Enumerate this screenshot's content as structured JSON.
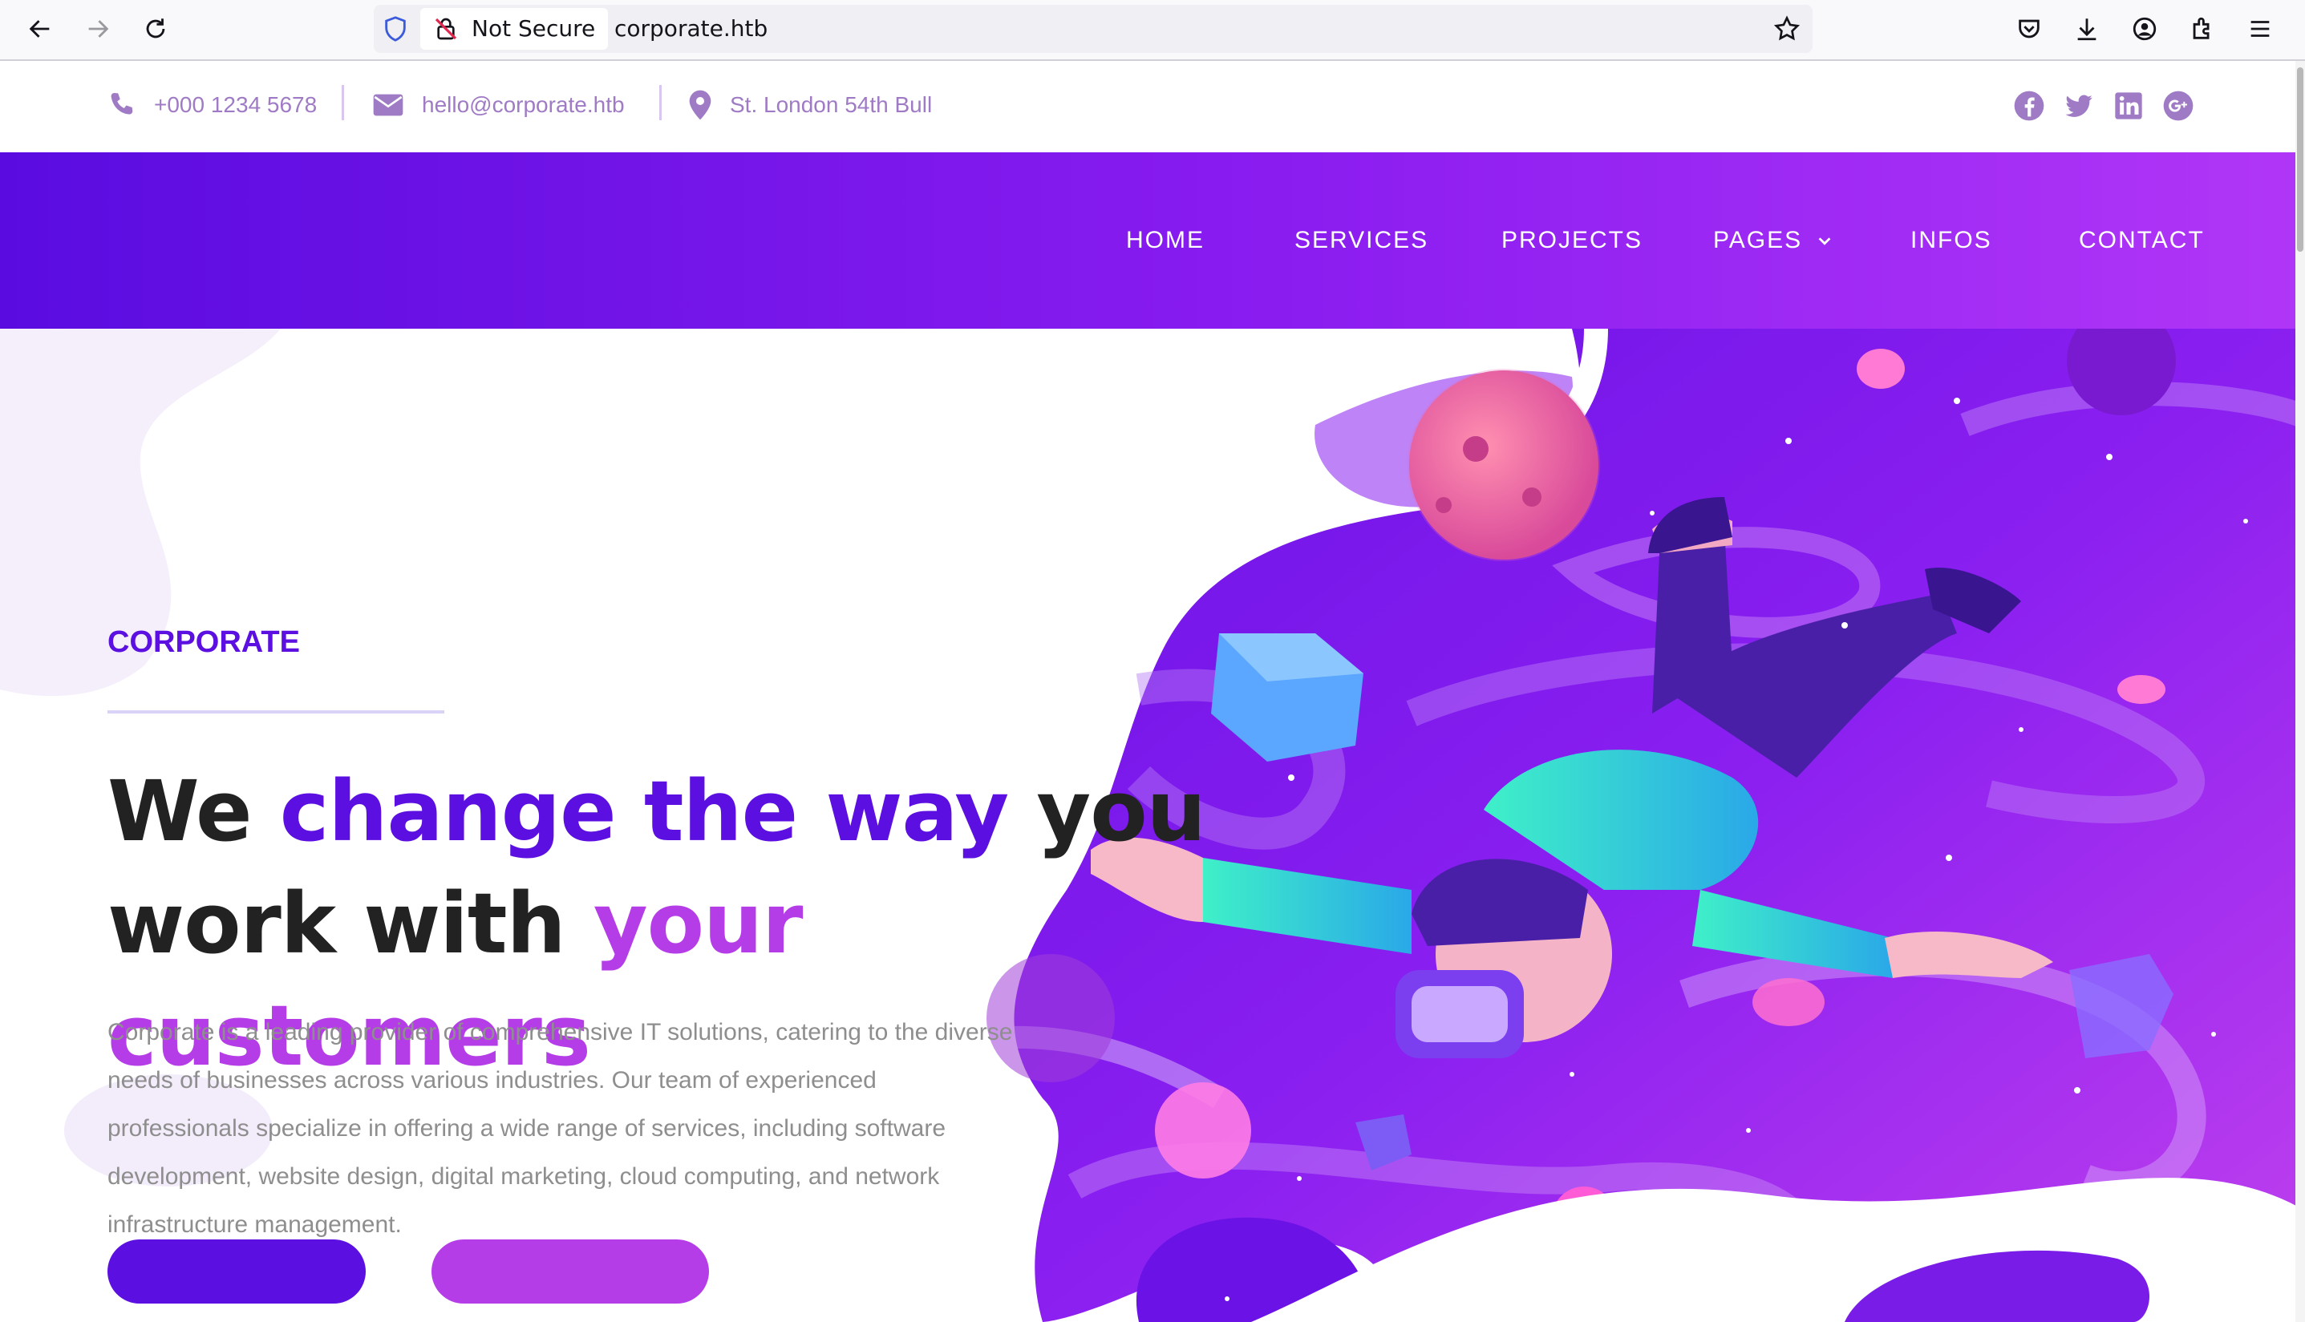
{
  "browser": {
    "security_label": "Not Secure",
    "url": "corporate.htb"
  },
  "topbar": {
    "phone": "+000 1234 5678",
    "email": "hello@corporate.htb",
    "address": "St. London 54th Bull",
    "socials": [
      "facebook-icon",
      "twitter-icon",
      "linkedin-icon",
      "google-plus-icon"
    ]
  },
  "nav": {
    "items": [
      {
        "label": "HOME"
      },
      {
        "label": "SERVICES"
      },
      {
        "label": "PROJECTS"
      },
      {
        "label": "PAGES"
      },
      {
        "label": "INFOS"
      },
      {
        "label": "CONTACT"
      }
    ]
  },
  "hero": {
    "kicker": "CORPORATE",
    "headline": {
      "part1": "We ",
      "part2": "change the way",
      "part3": " you",
      "part4": "work with ",
      "part5": "your customers"
    },
    "description": "Corporate is a leading provider of comprehensive IT solutions, catering to the diverse needs of businesses across various industries. Our team of experienced professionals specialize in offering a wide range of services, including software development, website design, digital marketing, cloud computing, and network infrastructure management."
  },
  "colors": {
    "brand_purple": "#5b0fe0",
    "brand_magenta": "#b53de8",
    "nav_gradient_start": "#5a0ce0",
    "nav_gradient_end": "#b136f7",
    "contact_text": "#a07bc5"
  }
}
